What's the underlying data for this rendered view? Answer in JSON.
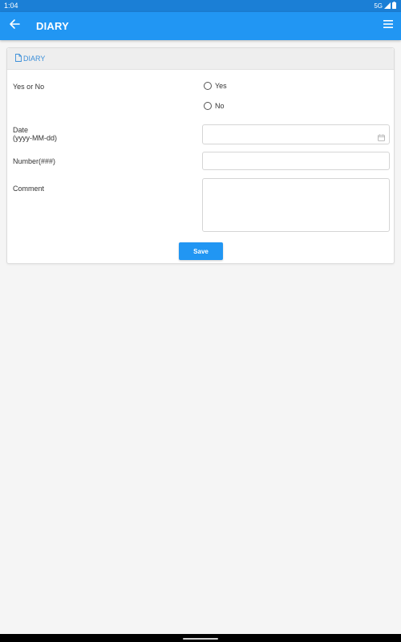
{
  "status_bar": {
    "time": "1:04",
    "network": "5G",
    "icons": [
      "signal-icon",
      "battery-icon"
    ]
  },
  "app_bar": {
    "title": "DIARY",
    "back_icon": "arrow-left-icon",
    "menu_icon": "hamburger-menu-icon"
  },
  "form": {
    "section_title": "DIARY",
    "section_icon": "document-icon",
    "fields": {
      "yes_no": {
        "label": "Yes or No",
        "options": [
          "Yes",
          "No"
        ],
        "selected": null
      },
      "date": {
        "label_line1": "Date",
        "label_line2": "(yyyy-MM-dd)",
        "value": "",
        "icon": "calendar-icon"
      },
      "number": {
        "label": "Number(###)",
        "value": ""
      },
      "comment": {
        "label": "Comment",
        "value": ""
      }
    },
    "save_label": "Save"
  },
  "colors": {
    "app_bar": "#2196f3",
    "status_bar": "#1b7fd6",
    "accent_text": "#3b8fd9",
    "background": "#f5f5f5"
  }
}
